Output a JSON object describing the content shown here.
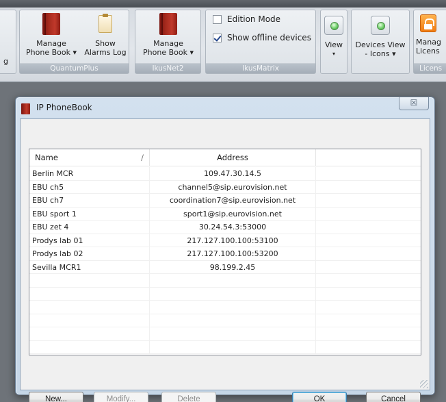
{
  "ribbon": {
    "quantumplus": {
      "caption": "QuantumPlus",
      "manage_phonebook": [
        "Manage",
        "Phone Book ▾"
      ],
      "show_alarms_log": [
        "Show",
        "Alarms Log"
      ]
    },
    "ikusnet2": {
      "caption": "IkusNet2",
      "manage_phonebook": [
        "Manage",
        "Phone Book ▾"
      ]
    },
    "ikusmatrix": {
      "caption": "IkusMatrix",
      "edition_mode": {
        "label": "Edition Mode",
        "checked": false
      },
      "show_offline": {
        "label": "Show offline devices",
        "checked": true
      }
    },
    "view": {
      "label": "View",
      "arrow": "▾"
    },
    "devices_view": [
      "Devices View",
      "- Icons ▾"
    ],
    "license": {
      "lines": [
        "Manag",
        "Licens"
      ],
      "caption": "Licens"
    }
  },
  "dialog": {
    "title": "IP PhoneBook",
    "close_glyph": "☒",
    "columns": {
      "name": "Name",
      "address": "Address",
      "sort_mark": "/"
    },
    "rows": [
      {
        "name": "Berlin MCR",
        "address": "109.47.30.14.5"
      },
      {
        "name": "EBU ch5",
        "address": "channel5@sip.eurovision.net"
      },
      {
        "name": "EBU ch7",
        "address": "coordination7@sip.eurovision.net"
      },
      {
        "name": "EBU sport 1",
        "address": "sport1@sip.eurovision.net"
      },
      {
        "name": "EBU zet 4",
        "address": "30.24.54.3:53000"
      },
      {
        "name": "Prodys lab 01",
        "address": "217.127.100.100:53100"
      },
      {
        "name": "Prodys lab 02",
        "address": "217.127.100.100:53200"
      },
      {
        "name": "Sevilla MCR1",
        "address": "98.199.2.45"
      },
      {
        "name": "",
        "address": ""
      },
      {
        "name": "",
        "address": ""
      },
      {
        "name": "",
        "address": ""
      },
      {
        "name": "",
        "address": ""
      },
      {
        "name": "",
        "address": ""
      },
      {
        "name": "",
        "address": ""
      }
    ],
    "buttons": {
      "new": "New...",
      "modify": "Modify...",
      "delete": "Delete",
      "ok": "OK",
      "cancel": "Cancel"
    }
  }
}
